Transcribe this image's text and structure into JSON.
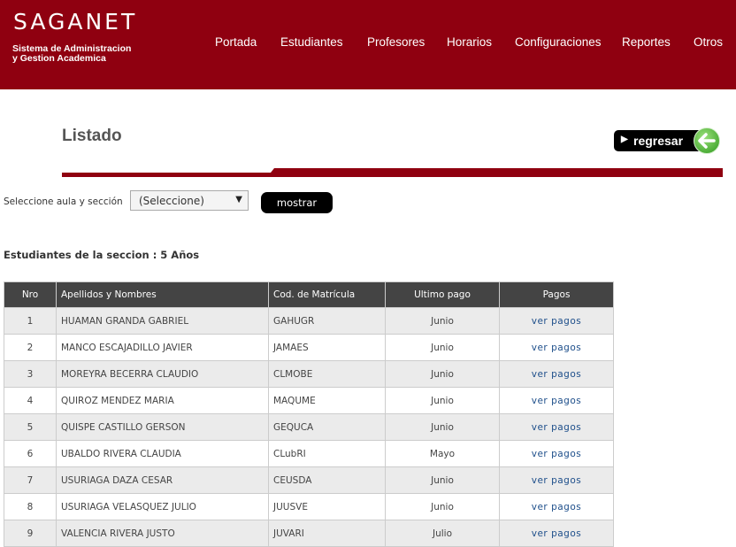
{
  "brand": {
    "title": "SAGANET",
    "subtitle_line1": "Sistema de Administracion",
    "subtitle_line2": "y Gestion Academica",
    "header_color": "#8f0010"
  },
  "nav": {
    "items": [
      {
        "label": "Portada"
      },
      {
        "label": "Estudiantes"
      },
      {
        "label": "Profesores"
      },
      {
        "label": "Horarios"
      },
      {
        "label": "Configuraciones"
      },
      {
        "label": "Reportes"
      },
      {
        "label": "Otros"
      }
    ]
  },
  "page": {
    "title": "Listado",
    "back_label": "regresar",
    "back_icon": "back-arrow-icon"
  },
  "filter": {
    "label": "Seleccione aula y sección",
    "select_value": "(Seleccione)",
    "button_label": "mostrar"
  },
  "section_title": "Estudiantes de la seccion : 5 Años",
  "table": {
    "headers": [
      "Nro",
      "Apellidos y Nombres",
      "Cod. de Matrícula",
      "Ultimo pago",
      "Pagos"
    ],
    "rows": [
      {
        "nro": "1",
        "name": "HUAMAN GRANDA  GABRIEL",
        "code": "GAHUGR",
        "last": "Junio",
        "link": "ver pagos"
      },
      {
        "nro": "2",
        "name": "MANCO ESCAJADILLO  JAVIER",
        "code": "JAMAES",
        "last": "Junio",
        "link": "ver pagos"
      },
      {
        "nro": "3",
        "name": "MOREYRA BECERRA  CLAUDIO",
        "code": "CLMOBE",
        "last": "Junio",
        "link": "ver pagos"
      },
      {
        "nro": "4",
        "name": "QUIROZ MENDEZ  MARIA",
        "code": "MAQUME",
        "last": "Junio",
        "link": "ver pagos"
      },
      {
        "nro": "5",
        "name": "QUISPE CASTILLO  GERSON",
        "code": "GEQUCA",
        "last": "Junio",
        "link": "ver pagos"
      },
      {
        "nro": "6",
        "name": "UBALDO RIVERA  CLAUDIA",
        "code": "CLubRI",
        "last": "Mayo",
        "link": "ver pagos"
      },
      {
        "nro": "7",
        "name": "USURIAGA DAZA  CESAR",
        "code": "CEUSDA",
        "last": "Junio",
        "link": "ver pagos"
      },
      {
        "nro": "8",
        "name": "USURIAGA VELASQUEZ  JULIO",
        "code": "JUUSVE",
        "last": "Junio",
        "link": "ver pagos"
      },
      {
        "nro": "9",
        "name": "VALENCIA RIVERA  JUSTO",
        "code": "JUVARI",
        "last": "Julio",
        "link": "ver pagos"
      }
    ]
  }
}
